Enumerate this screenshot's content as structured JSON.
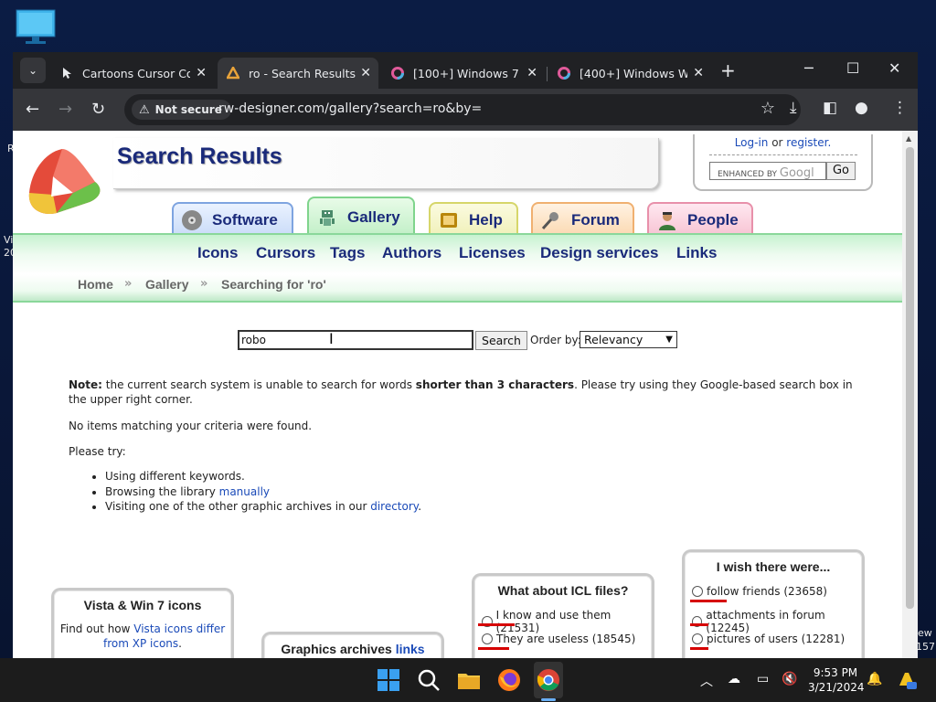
{
  "desktop": {
    "side_text_left_1": "R",
    "side_text_left_2": "Vi",
    "side_text_left_3": "20",
    "side_text_right_1": "ew",
    "side_text_right_2": "157"
  },
  "browser": {
    "tabs": [
      {
        "title": "Cartoons Cursor Coll",
        "close": "✕"
      },
      {
        "title": "ro - Search Results",
        "close": "✕"
      },
      {
        "title": "[100+] Windows 7 W",
        "close": "✕"
      },
      {
        "title": "[400+] Windows Wal",
        "close": "✕"
      }
    ],
    "new_tab": "+",
    "security_label": "Not secure",
    "url": "rw-designer.com/gallery?search=ro&by="
  },
  "page": {
    "title": "Search Results",
    "login_text": "Log-in",
    "or_text": " or ",
    "register_text": "register.",
    "google_placeholder": "ENHANCED BY",
    "google_word": "Googl",
    "go_label": "Go",
    "nav_tabs": [
      {
        "label": "Software"
      },
      {
        "label": "Gallery"
      },
      {
        "label": "Help"
      },
      {
        "label": "Forum"
      },
      {
        "label": "People"
      }
    ],
    "menu": [
      "Icons",
      "Cursors",
      "Tags",
      "Authors",
      "Licenses",
      "Design services",
      "Links"
    ],
    "breadcrumb": [
      "Home",
      "Gallery",
      "Searching for 'ro'"
    ],
    "breadcrumb_sep": "»",
    "search_value": "robo",
    "search_button": "Search",
    "orderby_label": "Order by:",
    "orderby_value": "Relevancy",
    "note_label": "Note:",
    "note_text_1": " the current search system is unable to search for words ",
    "note_bold": "shorter than 3 characters",
    "note_text_2": ". Please try using they Google-based search box in the upper right corner.",
    "no_items": "No items matching your criteria were found.",
    "please_try": "Please try:",
    "suggestion_1": "Using different keywords.",
    "suggestion_2_text": "Browsing the library ",
    "suggestion_2_link": "manually",
    "suggestion_3_text": "Visiting one of the other graphic archives in our ",
    "suggestion_3_link": "directory",
    "suggestion_3_end": ".",
    "panel_vista": {
      "title": "Vista & Win 7 icons",
      "text": "Find out how ",
      "link": "Vista icons differ from XP icons",
      "end": "."
    },
    "panel_archives": {
      "title": "Graphics archives ",
      "link": "links"
    },
    "poll_icl": {
      "title": "What about ICL files?",
      "options": [
        "I know and use them (21531)",
        "They are useless (18545)"
      ]
    },
    "poll_wish": {
      "title": "I wish there were...",
      "options": [
        "follow friends (23658)",
        "attachments in forum (12245)",
        "pictures of users (12281)"
      ]
    }
  },
  "taskbar": {
    "time": "9:53 PM",
    "date": "3/21/2024"
  }
}
